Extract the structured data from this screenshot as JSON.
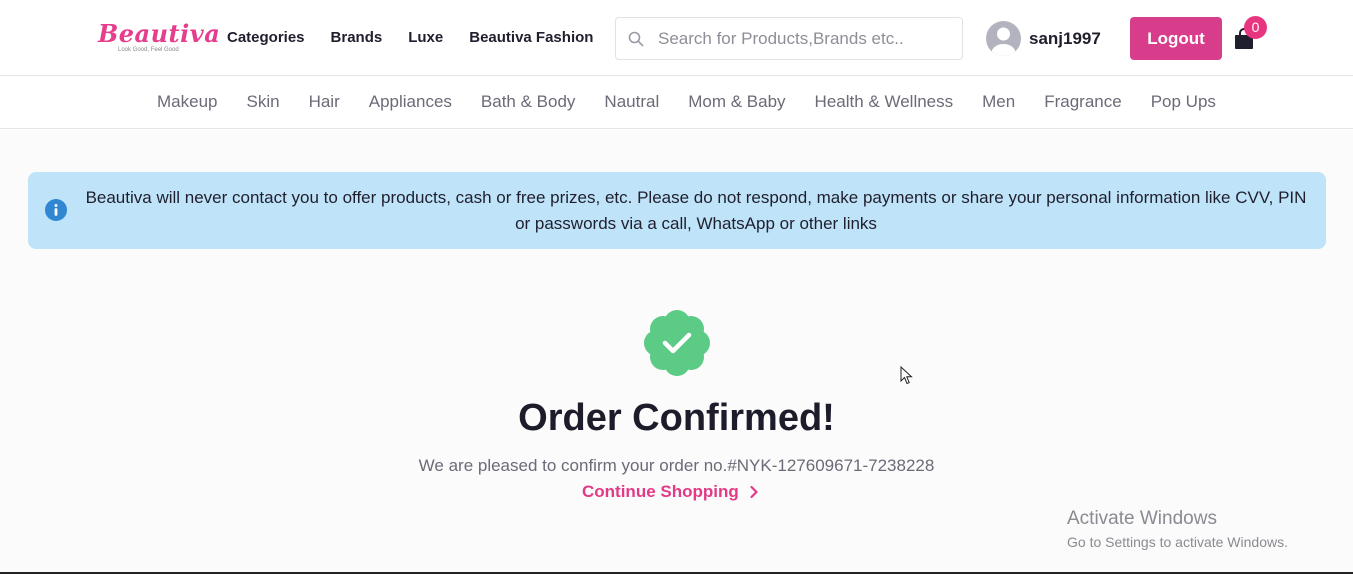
{
  "header": {
    "logo_text": "Beautiva",
    "logo_tagline": "Look Good, Feel Good",
    "nav": [
      "Categories",
      "Brands",
      "Luxe",
      "Beautiva Fashion"
    ],
    "search_placeholder": "Search for Products,Brands etc..",
    "username": "sanj1997",
    "logout_label": "Logout",
    "cart_count": "0"
  },
  "categories": [
    "Makeup",
    "Skin",
    "Hair",
    "Appliances",
    "Bath & Body",
    "Nautral",
    "Mom & Baby",
    "Health & Wellness",
    "Men",
    "Fragrance",
    "Pop Ups"
  ],
  "notice": {
    "text": "Beautiva will never contact you to offer products, cash or free prizes, etc. Please do not respond, make payments or share your personal information like CVV, PIN or passwords via a call, WhatsApp or other links"
  },
  "confirmation": {
    "title": "Order Confirmed!",
    "message": "We are pleased to confirm your order no.#NYK-127609671-7238228",
    "continue_label": "Continue Shopping"
  },
  "windows_watermark": {
    "title": "Activate Windows",
    "subtitle": "Go to Settings to activate Windows."
  },
  "colors": {
    "brand_pink": "#e33a86",
    "logout_bg": "#d83d8b",
    "notice_bg": "#bfe3f8",
    "success_green": "#5bcb85",
    "info_blue": "#2f86d1"
  },
  "icons": [
    "search-icon",
    "avatar-icon",
    "cart-icon",
    "info-icon",
    "verified-check-icon",
    "chevron-right-icon",
    "mouse-cursor-icon"
  ]
}
